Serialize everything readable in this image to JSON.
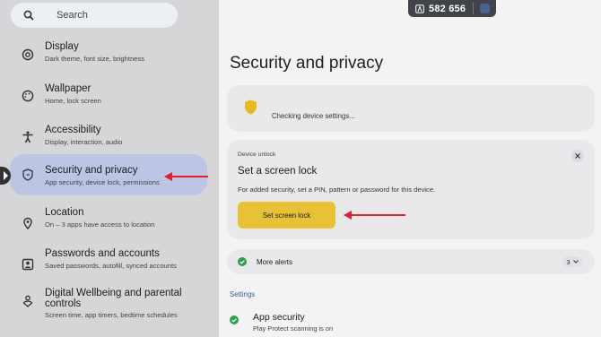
{
  "search": {
    "placeholder": "Search",
    "icon": "search-icon"
  },
  "sidebar": {
    "items": [
      {
        "title": "Display",
        "subtitle": "Dark theme, font size, brightness",
        "icon": "display-icon"
      },
      {
        "title": "Wallpaper",
        "subtitle": "Home, lock screen",
        "icon": "palette-icon"
      },
      {
        "title": "Accessibility",
        "subtitle": "Display, interaction, audio",
        "icon": "accessibility-icon"
      },
      {
        "title": "Security and privacy",
        "subtitle": "App security, device lock, permissions",
        "icon": "shield-icon",
        "selected": true
      },
      {
        "title": "Location",
        "subtitle": "On – 3 apps have access to location",
        "icon": "location-icon"
      },
      {
        "title": "Passwords and accounts",
        "subtitle": "Saved passwords, autofill, synced accounts",
        "icon": "account-icon"
      },
      {
        "title_line1": "Digital Wellbeing and parental",
        "title_line2": "controls",
        "subtitle": "Screen time, app timers, bedtime schedules",
        "icon": "wellbeing-icon"
      }
    ]
  },
  "overlay": {
    "counter": "582 656"
  },
  "main": {
    "title": "Security and privacy",
    "status_text": "Checking device settings...",
    "device_unlock": {
      "label": "Device unlock",
      "heading": "Set a screen lock",
      "description": "For added security, set a PIN, pattern or password for this device.",
      "button": "Set screen lock"
    },
    "alerts": {
      "label": "More alerts",
      "count": "3"
    },
    "settings_header": "Settings",
    "app_security": {
      "title": "App security",
      "subtitle": "Play Protect scanning is on"
    }
  },
  "colors": {
    "sidebar_bg": "#d6d6d9",
    "selected_bg": "#bcc5e4",
    "accent_yellow": "#e8c136",
    "status_green": "#2e9d4e",
    "arrow_red": "#e0202a",
    "link_blue": "#3c5a9a"
  }
}
